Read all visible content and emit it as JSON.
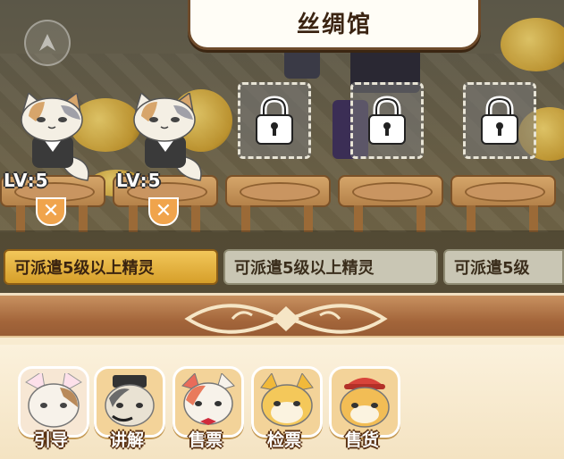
{
  "header": {
    "title": "丝绸馆"
  },
  "slots": [
    {
      "level": "LV:5",
      "occupied": true
    },
    {
      "level": "LV:5",
      "occupied": true
    },
    {
      "locked": true
    },
    {
      "locked": true
    },
    {
      "locked": true
    }
  ],
  "hints": [
    {
      "label": "可派遣5级以上精灵",
      "active": true
    },
    {
      "label": "可派遣5级以上精灵",
      "active": false
    },
    {
      "label": "可派遣5级",
      "active": false
    }
  ],
  "roles": [
    {
      "label": "引导",
      "icon": "guide-cat-icon"
    },
    {
      "label": "讲解",
      "icon": "narrator-cat-icon"
    },
    {
      "label": "售票",
      "icon": "ticket-seller-cat-icon"
    },
    {
      "label": "检票",
      "icon": "ticket-checker-cat-icon"
    },
    {
      "label": "售货",
      "icon": "shop-seller-cat-icon"
    }
  ],
  "colors": {
    "accent": "#f0a44c",
    "hint_active": "#e2b240",
    "banner_border": "#6e4b2b"
  }
}
